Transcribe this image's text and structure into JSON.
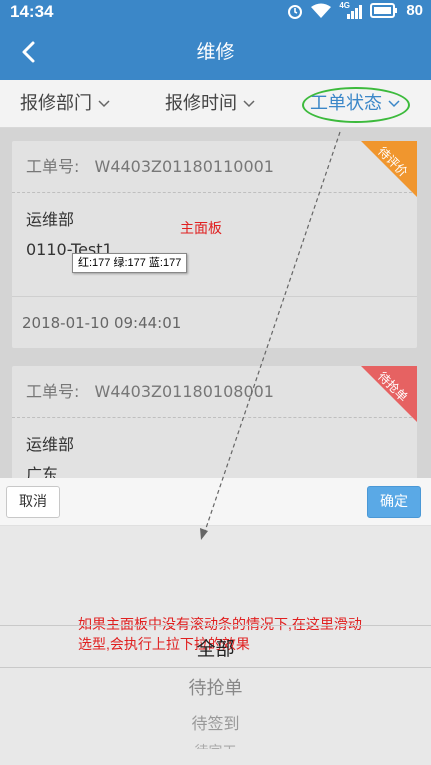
{
  "status_bar": {
    "time": "14:34",
    "network": "4G",
    "battery": "80"
  },
  "nav": {
    "title": "维修"
  },
  "filters": [
    {
      "label": "报修部门"
    },
    {
      "label": "报修时间"
    },
    {
      "label": "工单状态"
    }
  ],
  "cards": [
    {
      "order_label": "工单号:",
      "order_no": "W4403Z01180110001",
      "dept": "运维部",
      "name": "0110-Test1",
      "time": "2018-01-10 09:44:01",
      "badge": "待评价",
      "badge_color": "#f0962e"
    },
    {
      "order_label": "工单号:",
      "order_no": "W4403Z01180108001",
      "dept": "运维部",
      "name": "广东",
      "badge": "待抢单",
      "badge_color": "#e66262"
    }
  ],
  "annotations": {
    "main_panel": "主面板",
    "color_tip": "红:177 绿:177 蓝:177",
    "picker_note": "如果主面板中没有滚动条的情况下,在这里滑动选型,会执行上拉下拉的效果"
  },
  "picker": {
    "cancel_label": "取消",
    "ok_label": "确定",
    "options": [
      "全部",
      "待抢单",
      "待签到",
      "待完工"
    ]
  }
}
